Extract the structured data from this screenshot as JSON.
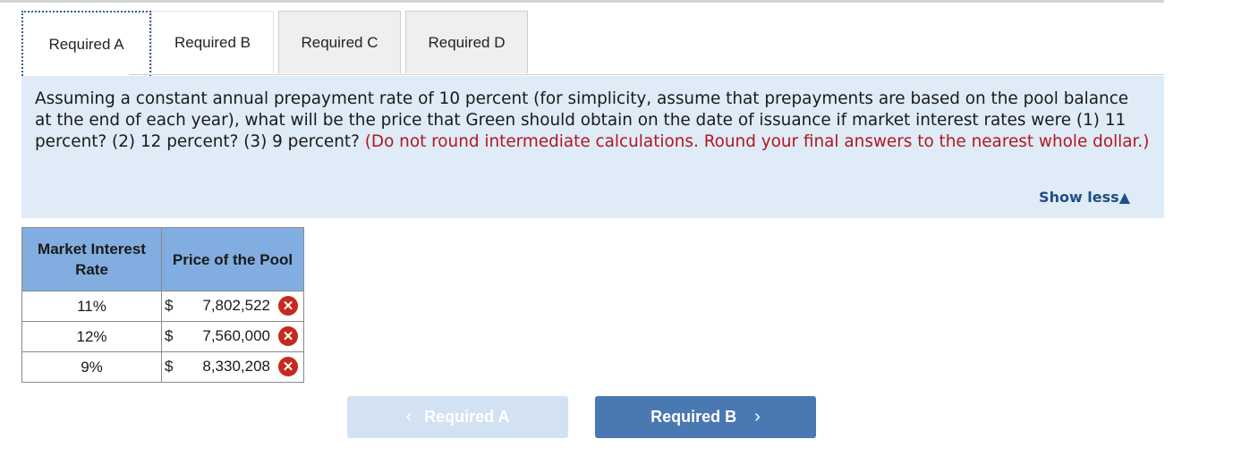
{
  "tabs": [
    {
      "label": "Required A",
      "active": true
    },
    {
      "label": "Required B",
      "active": false
    },
    {
      "label": "Required C",
      "active": false
    },
    {
      "label": "Required D",
      "active": false
    }
  ],
  "question": {
    "text": "Assuming a constant annual prepayment rate of 10 percent (for simplicity, assume that prepayments are based on the pool balance at the end of each year), what will be the price that Green should obtain on the date of issuance if market interest rates were (1) 11 percent? (2) 12 percent? (3) 9 percent?",
    "note": "(Do not round intermediate calculations. Round your final answers to the nearest whole dollar.)",
    "show_less": "Show less",
    "show_less_icon": "triangle-up-icon"
  },
  "table": {
    "headers": [
      "Market Interest Rate",
      "Price of the Pool"
    ],
    "rows": [
      {
        "rate": "11%",
        "currency": "$",
        "price": "7,802,522",
        "status": "incorrect"
      },
      {
        "rate": "12%",
        "currency": "$",
        "price": "7,560,000",
        "status": "incorrect"
      },
      {
        "rate": "9%",
        "currency": "$",
        "price": "8,330,208",
        "status": "incorrect"
      }
    ],
    "incorrect_icon": "x-circle-icon"
  },
  "navigation": {
    "prev_label": "Required A",
    "next_label": "Required B"
  },
  "colors": {
    "question_bg": "#dfebf7",
    "note_red": "#b2171d",
    "header_blue": "#82ade0",
    "next_button": "#4a78b3",
    "prev_button_disabled": "#d3e2f3",
    "incorrect_red": "#c62a1e"
  }
}
